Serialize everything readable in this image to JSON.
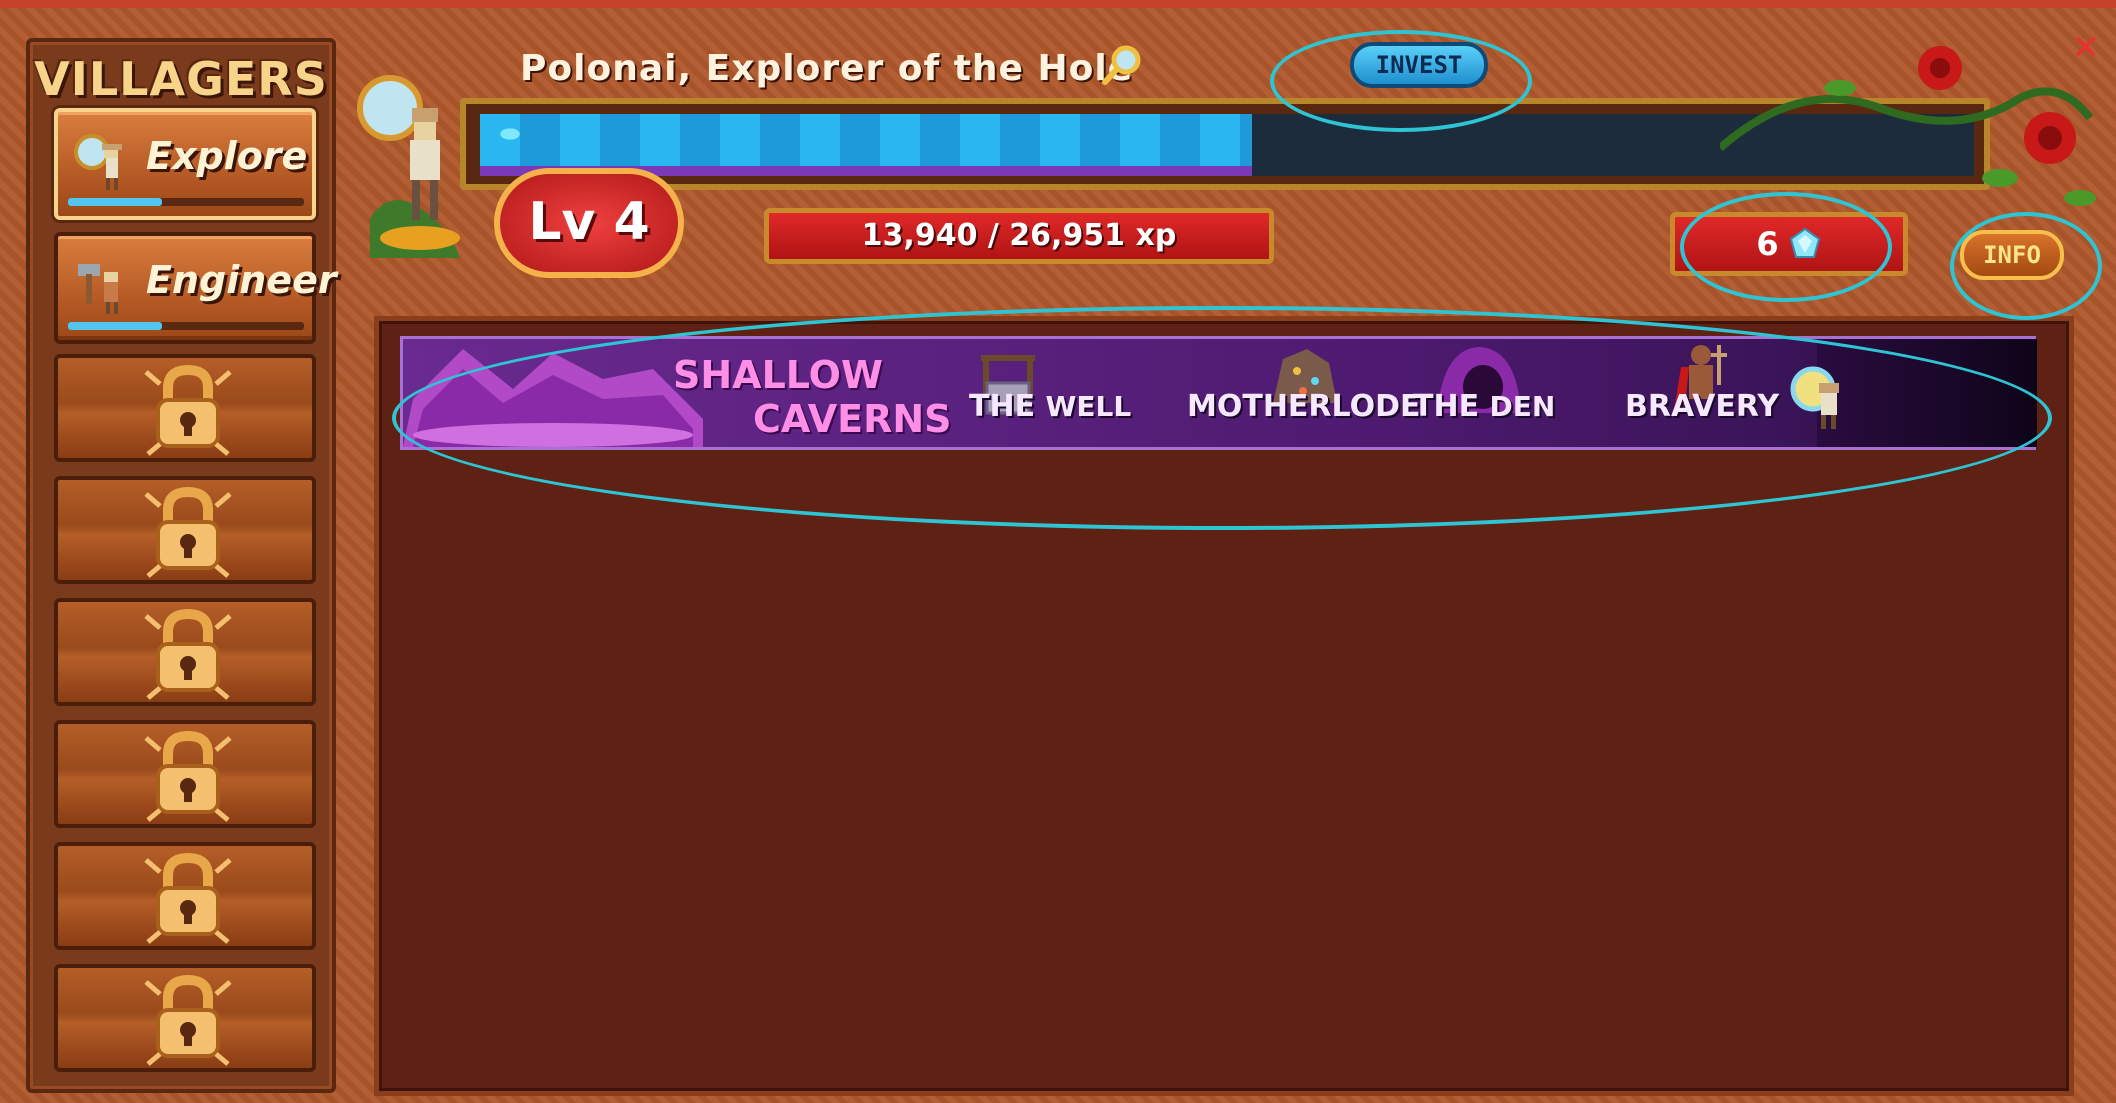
{
  "window": {
    "close_label": "✕"
  },
  "sidebar": {
    "title": "VILLAGERS",
    "villagers": [
      {
        "label": "Explore",
        "progress": 0.4,
        "icon": "explorer-villager-icon"
      },
      {
        "label": "Engineer",
        "progress": 0.4,
        "icon": "engineer-villager-icon"
      }
    ],
    "locked_slots": 6
  },
  "header": {
    "title": "Polonai, Explorer of the Hole",
    "invest_label": "INVEST",
    "xp_progress": 0.517,
    "level": "Lv 4",
    "xp_text": "13,940 / 26,951 xp",
    "currency_value": "6",
    "currency_icon": "gem-icon",
    "info_label": "INFO"
  },
  "zone": {
    "title_line1": "SHALLOW",
    "title_line2": "CAVERNS",
    "stages": [
      {
        "label_a": "THE",
        "label_b": "WELL",
        "icon": "well-icon"
      },
      {
        "label_a": "",
        "label_b": "MOTHERLODE",
        "icon": "ore-rock-icon"
      },
      {
        "label_a": "THE",
        "label_b": "DEN",
        "icon": "cave-den-icon"
      },
      {
        "label_a": "",
        "label_b": "BRAVERY",
        "icon": "bravery-statue-icon"
      }
    ],
    "current_marker_icon": "explorer-marker-icon"
  },
  "colors": {
    "accent_cyan": "#2fc4d4",
    "xp_fill": "#2ab6ee",
    "badge_red": "#d82020",
    "zone_pink": "#ff8ee6"
  }
}
